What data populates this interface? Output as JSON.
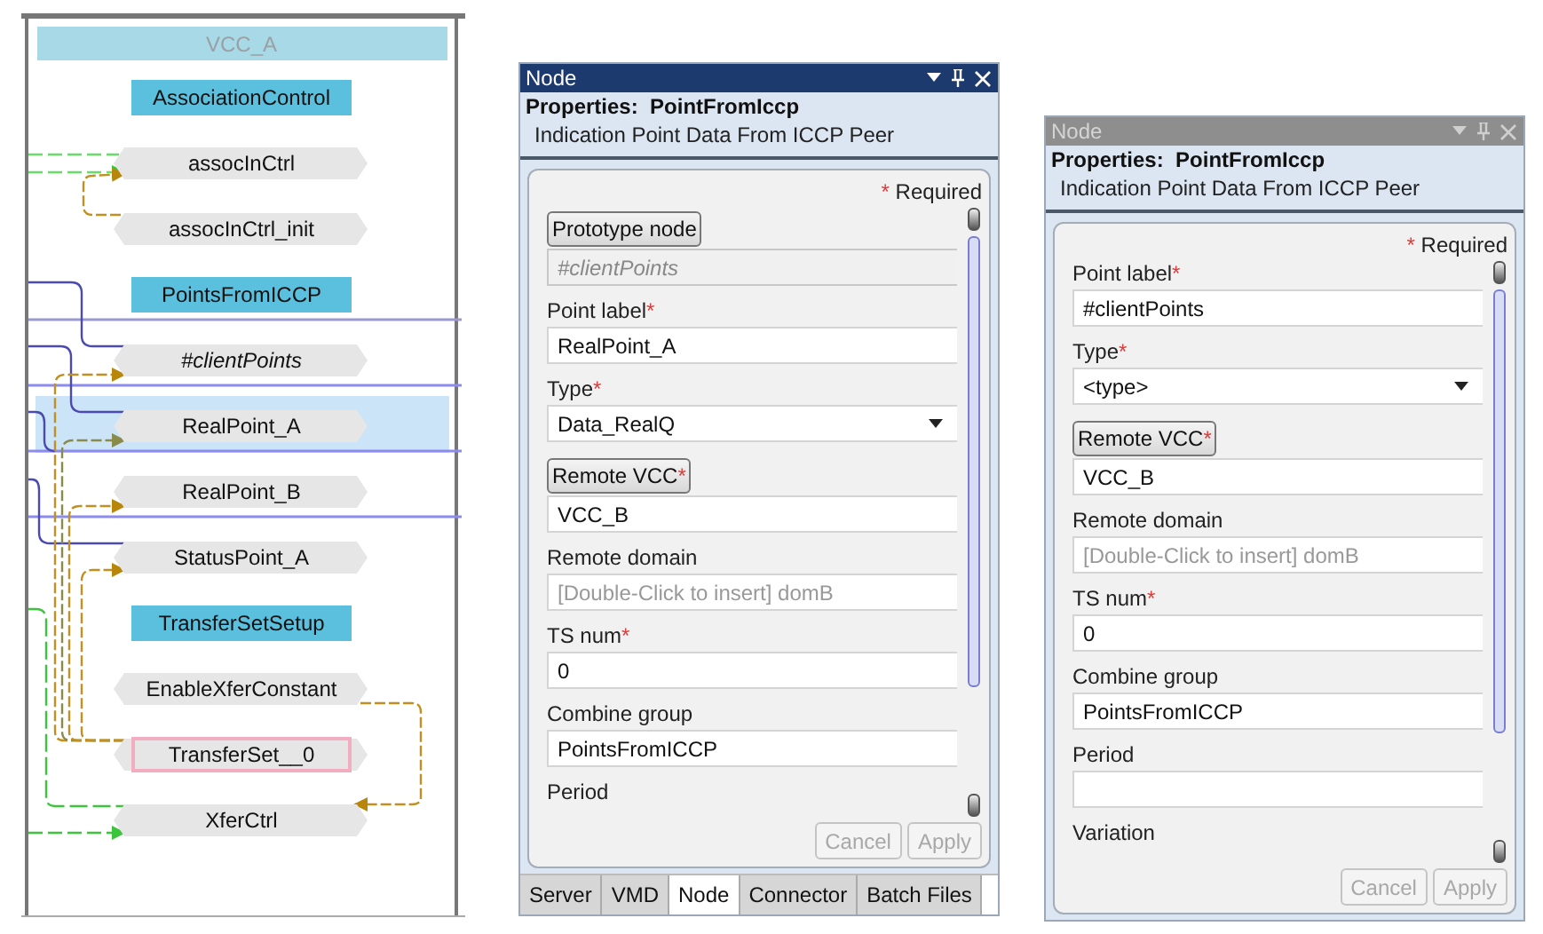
{
  "diagram": {
    "title": "VCC_A",
    "nodes": [
      {
        "label": "AssociationControl",
        "kind": "group",
        "selected": false,
        "highlighted": false
      },
      {
        "label": "assocInCtrl",
        "kind": "node",
        "selected": false,
        "highlighted": false
      },
      {
        "label": "assocInCtrl_init",
        "kind": "node",
        "selected": false,
        "highlighted": false
      },
      {
        "label": "PointsFromICCP",
        "kind": "group",
        "selected": false,
        "highlighted": false
      },
      {
        "label": "#clientPoints",
        "kind": "prototype",
        "selected": false,
        "highlighted": false
      },
      {
        "label": "RealPoint_A",
        "kind": "node",
        "selected": true,
        "highlighted": false
      },
      {
        "label": "RealPoint_B",
        "kind": "node",
        "selected": false,
        "highlighted": false
      },
      {
        "label": "StatusPoint_A",
        "kind": "node",
        "selected": false,
        "highlighted": false
      },
      {
        "label": "TransferSetSetup",
        "kind": "group",
        "selected": false,
        "highlighted": false
      },
      {
        "label": "EnableXferConstant",
        "kind": "node",
        "selected": false,
        "highlighted": false
      },
      {
        "label": "TransferSet__0",
        "kind": "node",
        "selected": false,
        "highlighted": true
      },
      {
        "label": "XferCtrl",
        "kind": "node",
        "selected": false,
        "highlighted": false
      }
    ]
  },
  "panels": [
    {
      "title": "Node",
      "active": true,
      "heading": "Properties:  PointFromIccp",
      "subtitle": "Indication Point Data From ICCP Peer",
      "required_mark": "*",
      "required_note": "Required",
      "fields": [
        {
          "kind": "button-label",
          "label": "Prototype node",
          "required": false,
          "value": "#clientPoints",
          "readonly": true
        },
        {
          "kind": "text",
          "label": "Point label",
          "required": true,
          "value": "RealPoint_A"
        },
        {
          "kind": "dropdown",
          "label": "Type",
          "required": true,
          "value": "Data_RealQ"
        },
        {
          "kind": "button-label",
          "label": "Remote VCC",
          "required": true,
          "value": "VCC_B",
          "readonly": false
        },
        {
          "kind": "text",
          "label": "Remote domain",
          "required": false,
          "placeholder": "[Double-Click to insert] domB"
        },
        {
          "kind": "text",
          "label": "TS num",
          "required": true,
          "value": "0"
        },
        {
          "kind": "text",
          "label": "Combine group",
          "required": false,
          "value": "PointsFromICCP"
        },
        {
          "kind": "label-only",
          "label": "Period",
          "required": false
        }
      ],
      "buttons": [
        {
          "label": "Cancel",
          "disabled": true
        },
        {
          "label": "Apply",
          "disabled": true
        }
      ],
      "tabs": [
        {
          "label": "Server",
          "selected": false
        },
        {
          "label": "VMD",
          "selected": false
        },
        {
          "label": "Node",
          "selected": true
        },
        {
          "label": "Connector",
          "selected": false
        },
        {
          "label": "Batch Files",
          "selected": false
        }
      ]
    },
    {
      "title": "Node",
      "active": false,
      "heading": "Properties:  PointFromIccp",
      "subtitle": "Indication Point Data From ICCP Peer",
      "required_mark": "*",
      "required_note": "Required",
      "fields": [
        {
          "kind": "text",
          "label": "Point label",
          "required": true,
          "value": "#clientPoints"
        },
        {
          "kind": "dropdown",
          "label": "Type",
          "required": true,
          "value": "<type>"
        },
        {
          "kind": "button-label",
          "label": "Remote VCC",
          "required": true,
          "value": "VCC_B",
          "readonly": false
        },
        {
          "kind": "text",
          "label": "Remote domain",
          "required": false,
          "placeholder": "[Double-Click to insert] domB"
        },
        {
          "kind": "text",
          "label": "TS num",
          "required": true,
          "value": "0"
        },
        {
          "kind": "text",
          "label": "Combine group",
          "required": false,
          "value": "PointsFromICCP"
        },
        {
          "kind": "text",
          "label": "Period",
          "required": false
        },
        {
          "kind": "label-only",
          "label": "Variation",
          "required": false
        }
      ],
      "buttons": [
        {
          "label": "Cancel",
          "disabled": true
        },
        {
          "label": "Apply",
          "disabled": true
        }
      ]
    }
  ]
}
